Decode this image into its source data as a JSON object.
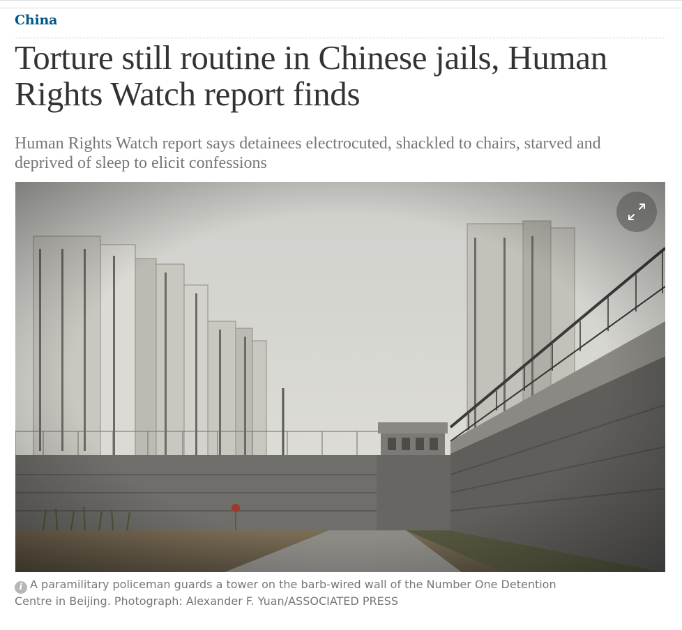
{
  "article": {
    "section": "China",
    "headline": "Torture still routine in Chinese jails, Human Rights Watch report finds",
    "standfirst": "Human Rights Watch report says detainees electrocuted, shackled to chairs, starved and deprived of sleep to elicit confessions",
    "image": {
      "description": "Grey prison wall with barbed-wire fence and guard tower, high-rise apartment blocks behind",
      "caption": "A paramilitary policeman guards a tower on the barb-wired wall of the Number One Detention Centre in Beijing. Photograph: Alexander F. Yuan/ASSOCIATED PRESS"
    }
  },
  "icons": {
    "expand": "expand-icon",
    "info": "info-icon"
  },
  "colors": {
    "section": "#005689",
    "headline": "#333333",
    "standfirst": "#767676",
    "caption": "#767676"
  }
}
